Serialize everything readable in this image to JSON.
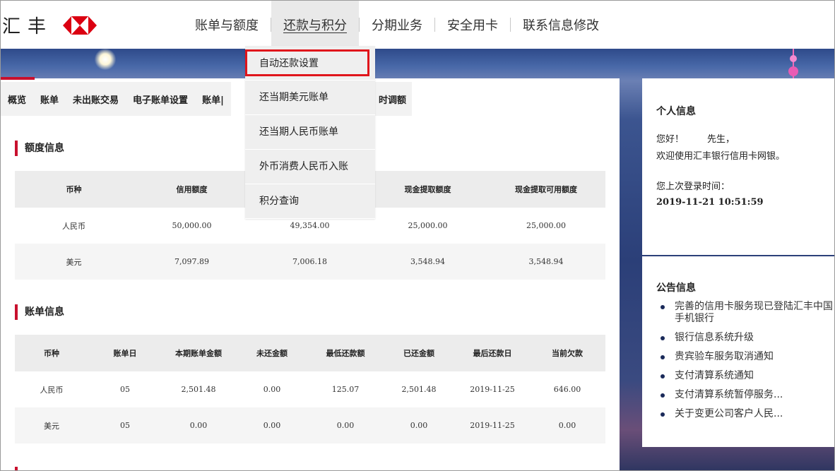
{
  "header": {
    "logo_text": "汇丰",
    "nav": [
      {
        "label": "账单与额度"
      },
      {
        "label": "还款与积分",
        "active": true
      },
      {
        "label": "分期业务"
      },
      {
        "label": "安全用卡"
      },
      {
        "label": "联系信息修改"
      }
    ]
  },
  "dropdown": {
    "items": [
      {
        "label": "自动还款设置",
        "highlighted": true
      },
      {
        "label": "还当期美元账单"
      },
      {
        "label": "还当期人民币账单"
      },
      {
        "label": "外币消费人民币入账"
      },
      {
        "label": "积分查询"
      }
    ]
  },
  "subnav": {
    "items": [
      "概览",
      "账单",
      "未出账交易",
      "电子账单设置",
      "账单|"
    ],
    "tail": "时调额"
  },
  "credit_section": {
    "title": "额度信息",
    "headers": [
      "币种",
      "信用额度",
      "",
      "现金提取额度",
      "现金提取可用额度"
    ],
    "rows": [
      [
        "人民币",
        "50,000.00",
        "49,354.00",
        "25,000.00",
        "25,000.00"
      ],
      [
        "美元",
        "7,097.89",
        "7,006.18",
        "3,548.94",
        "3,548.94"
      ]
    ]
  },
  "bill_section": {
    "title": "账单信息",
    "headers": [
      "币种",
      "账单日",
      "本期账单金额",
      "未还金额",
      "最低还款额",
      "已还金额",
      "最后还款日",
      "当前欠款"
    ],
    "rows": [
      [
        "人民币",
        "05",
        "2,501.48",
        "0.00",
        "125.07",
        "2,501.48",
        "2019-11-25",
        "646.00"
      ],
      [
        "美元",
        "05",
        "0.00",
        "0.00",
        "0.00",
        "0.00",
        "2019-11-25",
        "0.00"
      ]
    ]
  },
  "personal": {
    "title": "个人信息",
    "greeting": "您好！        先生，",
    "welcome": "欢迎使用汇丰银行信用卡网银。",
    "last_login_label": "您上次登录时间：",
    "last_login_value": "2019-11-21 10:51:59"
  },
  "notices": {
    "title": "公告信息",
    "items": [
      "完善的信用卡服务现已登陆汇丰中国手机银行",
      "银行信息系统升级",
      "贵宾验车服务取消通知",
      "支付清算系统通知",
      "支付清算系统暂停服务...",
      "关于变更公司客户人民..."
    ]
  },
  "colors": {
    "brand_red": "#c8102e",
    "highlight_red": "#e0151b"
  }
}
